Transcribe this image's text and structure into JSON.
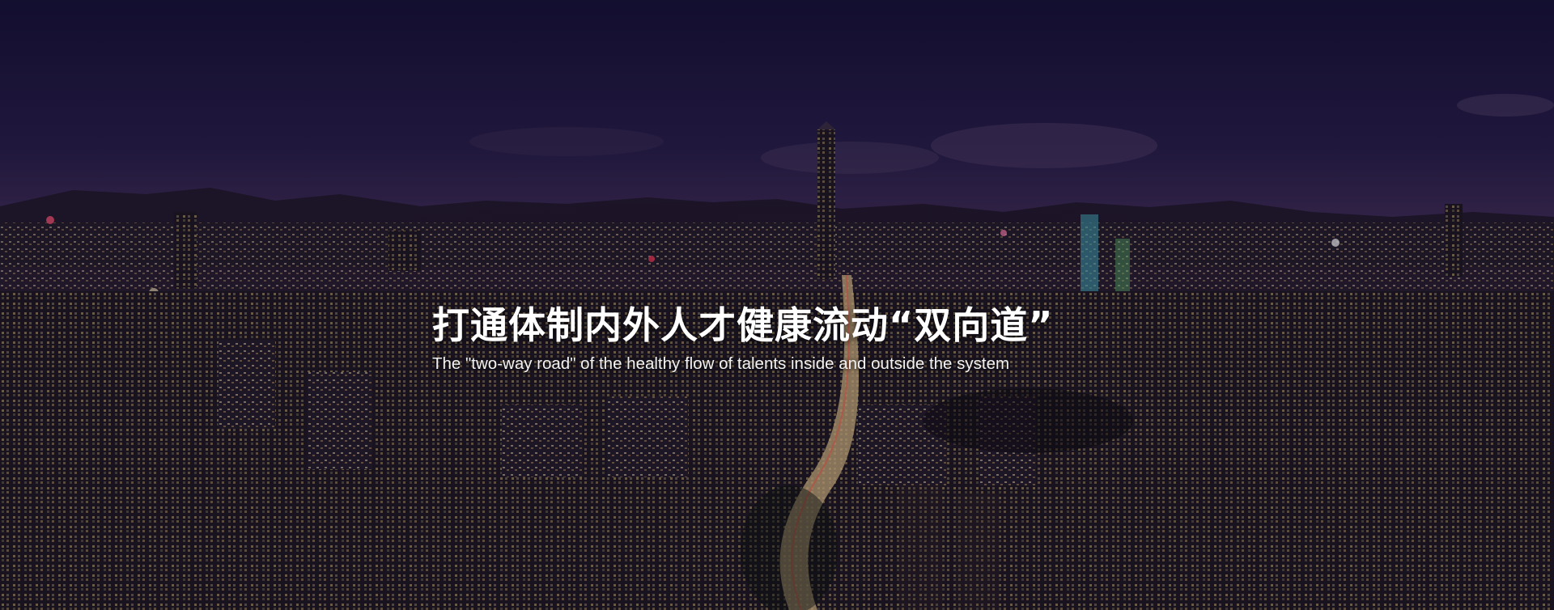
{
  "banner": {
    "title": "打通体制内外人才健康流动“双向道”",
    "subtitle": "The \"two-way road\" of the healthy flow of talents inside and outside the system",
    "overlay_color": "#0a0616"
  }
}
